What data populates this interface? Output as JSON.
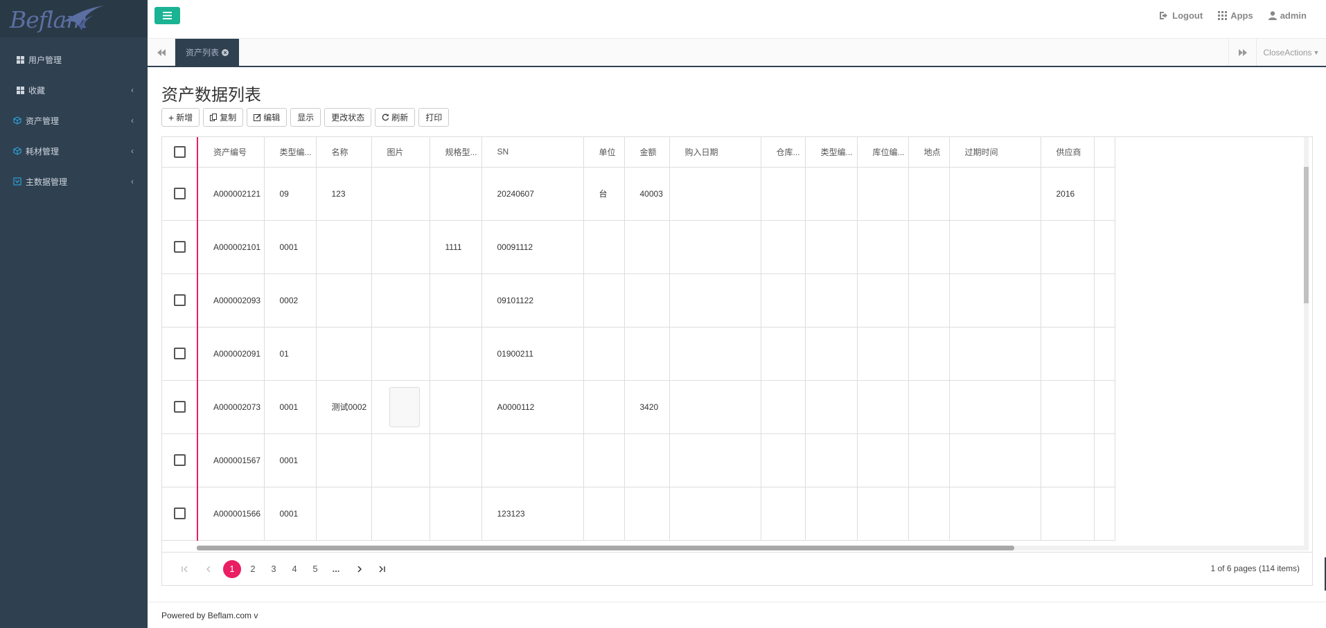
{
  "brand": {
    "logo_text": "Beflam"
  },
  "sidebar": {
    "items": [
      {
        "label": "用户管理",
        "icon": "grid-icon",
        "has_children": false
      },
      {
        "label": "收藏",
        "icon": "grid-icon",
        "has_children": true
      },
      {
        "label": "资产管理",
        "icon": "cube-icon",
        "has_children": true
      },
      {
        "label": "耗材管理",
        "icon": "cube-icon",
        "has_children": true
      },
      {
        "label": "主数据管理",
        "icon": "database-icon",
        "has_children": true
      }
    ]
  },
  "header": {
    "logout": "Logout",
    "apps": "Apps",
    "user": "admin"
  },
  "tabs": {
    "active": "资产列表",
    "close_actions": "CloseActions"
  },
  "page": {
    "title": "资产数据列表"
  },
  "toolbar": {
    "add": "新增",
    "copy": "复制",
    "edit": "编辑",
    "show": "显示",
    "change_status": "更改状态",
    "refresh": "刷新",
    "print": "打印"
  },
  "table": {
    "columns": [
      "资产编号",
      "类型编...",
      "名称",
      "图片",
      "规格型...",
      "SN",
      "单位",
      "金额",
      "购入日期",
      "仓库...",
      "类型编...",
      "库位编...",
      "地点",
      "过期时间",
      "供应商"
    ],
    "rows": [
      [
        "A000002121",
        "09",
        "123",
        "",
        "",
        "20240607",
        "台",
        "40003",
        "",
        "",
        "",
        "",
        "",
        "",
        "2016"
      ],
      [
        "A000002101",
        "0001",
        "",
        "",
        "1111",
        "00091112",
        "",
        "",
        "",
        "",
        "",
        "",
        "",
        "",
        ""
      ],
      [
        "A000002093",
        "0002",
        "",
        "",
        "",
        "09101122",
        "",
        "",
        "",
        "",
        "",
        "",
        "",
        "",
        ""
      ],
      [
        "A000002091",
        "01",
        "",
        "",
        "",
        "01900211",
        "",
        "",
        "",
        "",
        "",
        "",
        "",
        "",
        ""
      ],
      [
        "A000002073",
        "0001",
        "测试0002",
        "tablet-image",
        "",
        "A0000112",
        "",
        "3420",
        "",
        "",
        "",
        "",
        "",
        "",
        ""
      ],
      [
        "A000001567",
        "0001",
        "",
        "",
        "",
        "",
        "",
        "",
        "",
        "",
        "",
        "",
        "",
        "",
        ""
      ],
      [
        "A000001566",
        "0001",
        "",
        "",
        "",
        "123123",
        "",
        "",
        "",
        "",
        "",
        "",
        "",
        "",
        ""
      ]
    ]
  },
  "pager": {
    "pages": [
      "1",
      "2",
      "3",
      "4",
      "5",
      "..."
    ],
    "current": "1",
    "info": "1 of 6 pages (114 items)"
  },
  "footer": {
    "text": "Powered by Beflam.com v"
  }
}
